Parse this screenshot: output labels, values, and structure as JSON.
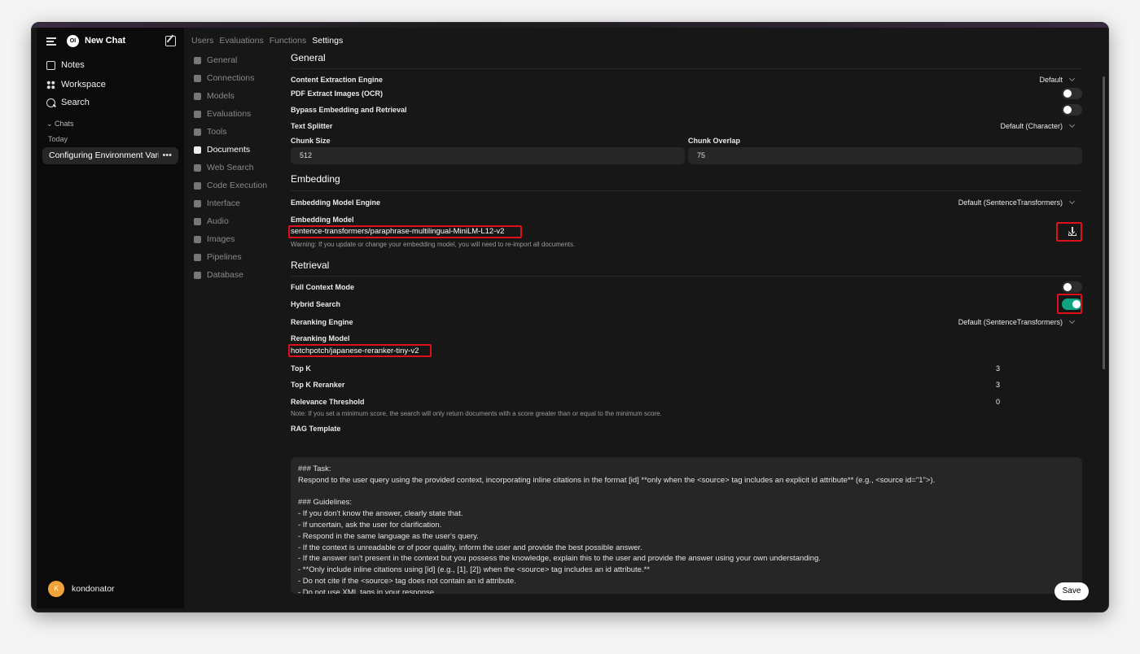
{
  "sidebar": {
    "new_chat": "New Chat",
    "logo_text": "OI",
    "items": [
      {
        "label": "Notes",
        "icon": "notes-icon"
      },
      {
        "label": "Workspace",
        "icon": "workspace-icon"
      },
      {
        "label": "Search",
        "icon": "search-icon"
      }
    ],
    "chats_header": "Chats",
    "today": "Today",
    "chat_item": "Configuring Environment Variables",
    "chat_more": "•••",
    "user": {
      "initial": "K",
      "name": "kondonator"
    }
  },
  "tabs": [
    "Users",
    "Evaluations",
    "Functions",
    "Settings"
  ],
  "settings_nav": [
    "General",
    "Connections",
    "Models",
    "Evaluations",
    "Tools",
    "Documents",
    "Web Search",
    "Code Execution",
    "Interface",
    "Audio",
    "Images",
    "Pipelines",
    "Database"
  ],
  "general": {
    "title": "General",
    "content_extraction_label": "Content Extraction Engine",
    "content_extraction_value": "Default",
    "pdf_ocr_label": "PDF Extract Images (OCR)",
    "bypass_label": "Bypass Embedding and Retrieval",
    "text_splitter_label": "Text Splitter",
    "text_splitter_value": "Default (Character)",
    "chunk_size_label": "Chunk Size",
    "chunk_size_value": "512",
    "chunk_overlap_label": "Chunk Overlap",
    "chunk_overlap_value": "75"
  },
  "embedding": {
    "title": "Embedding",
    "engine_label": "Embedding Model Engine",
    "engine_value": "Default (SentenceTransformers)",
    "model_label": "Embedding Model",
    "model_value": "sentence-transformers/paraphrase-multilingual-MiniLM-L12-v2",
    "warning": "Warning: If you update or change your embedding model, you will need to re-import all documents."
  },
  "retrieval": {
    "title": "Retrieval",
    "full_context_label": "Full Context Mode",
    "hybrid_label": "Hybrid Search",
    "reranking_engine_label": "Reranking Engine",
    "reranking_engine_value": "Default (SentenceTransformers)",
    "reranking_model_label": "Reranking Model",
    "reranking_model_value": "hotchpotch/japanese-reranker-tiny-v2",
    "topk_label": "Top K",
    "topk_value": "3",
    "topk_reranker_label": "Top K Reranker",
    "topk_reranker_value": "3",
    "relevance_label": "Relevance Threshold",
    "relevance_value": "0",
    "note": "Note: If you set a minimum score, the search will only return documents with a score greater than or equal to the minimum score.",
    "rag_label": "RAG Template",
    "rag_template": "### Task:\nRespond to the user query using the provided context, incorporating inline citations in the format [id] **only when the <source> tag includes an explicit id attribute** (e.g., <source id=\"1\">).\n\n### Guidelines:\n- If you don't know the answer, clearly state that.\n- If uncertain, ask the user for clarification.\n- Respond in the same language as the user's query.\n- If the context is unreadable or of poor quality, inform the user and provide the best possible answer.\n- If the answer isn't present in the context but you possess the knowledge, explain this to the user and provide the answer using your own understanding.\n- **Only include inline citations using [id] (e.g., [1], [2]) when the <source> tag includes an id attribute.**\n- Do not cite if the <source> tag does not contain an id attribute.\n- Do not use XML tags in your response."
  },
  "save_label": "Save"
}
